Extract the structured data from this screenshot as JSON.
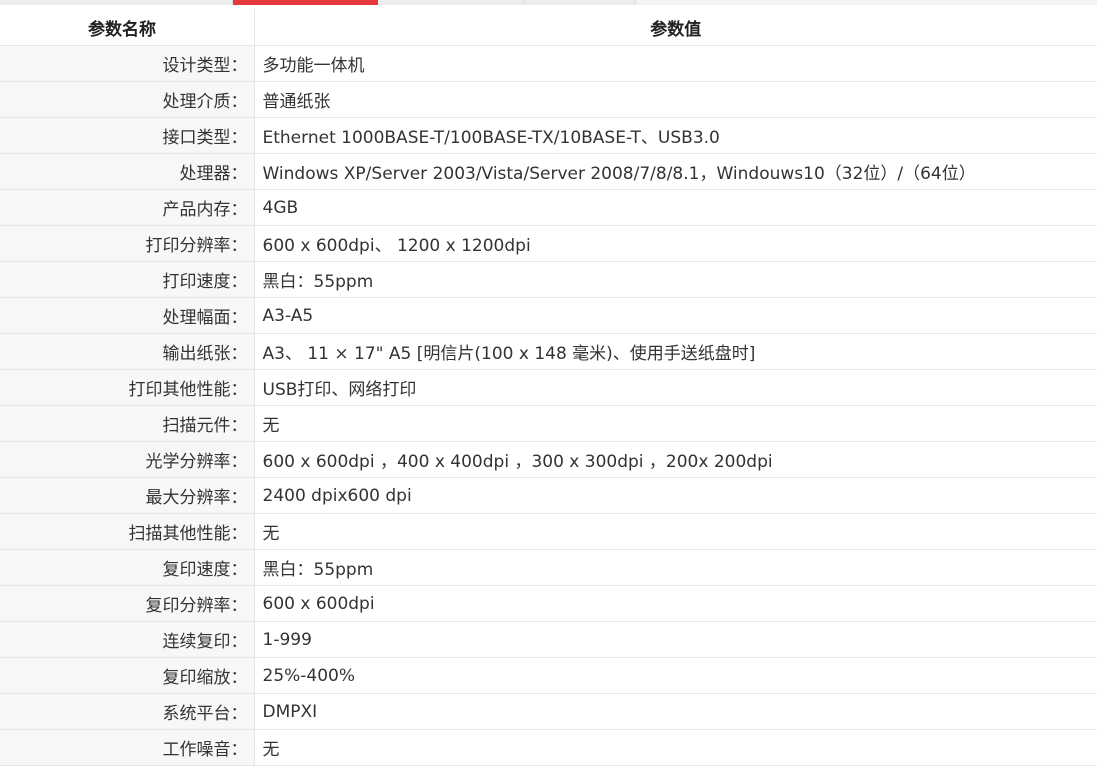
{
  "header": {
    "name_col": "参数名称",
    "value_col": "参数值"
  },
  "rows": [
    {
      "name": "设计类型：",
      "value": "多功能一体机"
    },
    {
      "name": "处理介质：",
      "value": "普通纸张"
    },
    {
      "name": "接口类型：",
      "value": "Ethernet 1000BASE-T/100BASE-TX/10BASE-T、USB3.0"
    },
    {
      "name": "处理器：",
      "value": "Windows XP/Server 2003/Vista/Server 2008/7/8/8.1，Windouws10（32位）/（64位）"
    },
    {
      "name": "产品内存：",
      "value": "4GB"
    },
    {
      "name": "打印分辨率：",
      "value": "600 x 600dpi、 1200 x 1200dpi"
    },
    {
      "name": "打印速度：",
      "value": "黑白：55ppm"
    },
    {
      "name": "处理幅面：",
      "value": "A3-A5"
    },
    {
      "name": "输出纸张：",
      "value": "A3、 11 × 17\" A5 [明信片(100 x 148 毫米)、使用手送纸盘时]"
    },
    {
      "name": "打印其他性能：",
      "value": "USB打印、网络打印"
    },
    {
      "name": "扫描元件：",
      "value": "无"
    },
    {
      "name": "光学分辨率：",
      "value": "600 x 600dpi ，400 x 400dpi ，300 x 300dpi ，200x 200dpi"
    },
    {
      "name": "最大分辨率：",
      "value": "2400 dpix600 dpi"
    },
    {
      "name": "扫描其他性能：",
      "value": "无"
    },
    {
      "name": "复印速度：",
      "value": "黑白：55ppm"
    },
    {
      "name": "复印分辨率：",
      "value": "600 x 600dpi"
    },
    {
      "name": "连续复印：",
      "value": "1-999"
    },
    {
      "name": "复印缩放：",
      "value": "25%-400%"
    },
    {
      "name": "系统平台：",
      "value": "DMPXI"
    },
    {
      "name": "工作噪音：",
      "value": "无"
    }
  ]
}
